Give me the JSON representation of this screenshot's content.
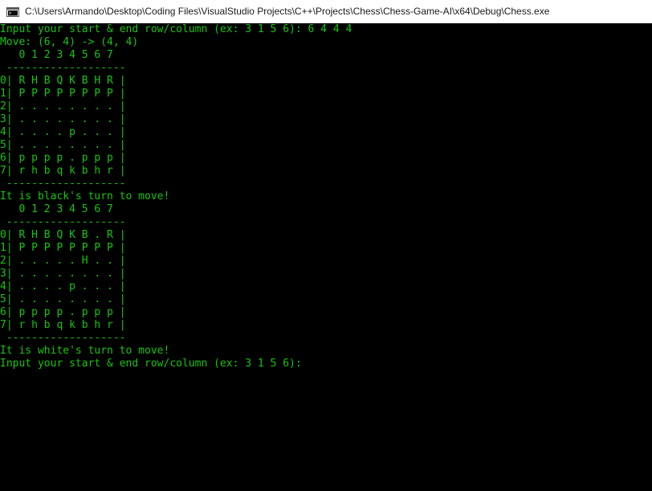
{
  "window": {
    "title": "C:\\Users\\Armando\\Desktop\\Coding Files\\VisualStudio Projects\\C++\\Projects\\Chess\\Chess-Game-AI\\x64\\Debug\\Chess.exe",
    "icon": "console-app-icon"
  },
  "colors": {
    "console_text": "#16c60c",
    "console_background": "#000000",
    "titlebar_background": "#ffffff"
  },
  "console": {
    "lines": [
      "Input your start & end row/column (ex: 3 1 5 6): 6 4 4 4",
      "Move: (6, 4) -> (4, 4)",
      "   0 1 2 3 4 5 6 7",
      " -------------------",
      "0| R H B Q K B H R |",
      "1| P P P P P P P P |",
      "2| . . . . . . . . |",
      "3| . . . . . . . . |",
      "4| . . . . p . . . |",
      "5| . . . . . . . . |",
      "6| p p p p . p p p |",
      "7| r h b q k b h r |",
      " -------------------",
      "It is black's turn to move!",
      "   0 1 2 3 4 5 6 7",
      " -------------------",
      "0| R H B Q K B . R |",
      "1| P P P P P P P P |",
      "2| . . . . . H . . |",
      "3| . . . . . . . . |",
      "4| . . . . p . . . |",
      "5| . . . . . . . . |",
      "6| p p p p . p p p |",
      "7| r h b q k b h r |",
      " -------------------",
      "It is white's turn to move!",
      "Input your start & end row/column (ex: 3 1 5 6):"
    ]
  }
}
